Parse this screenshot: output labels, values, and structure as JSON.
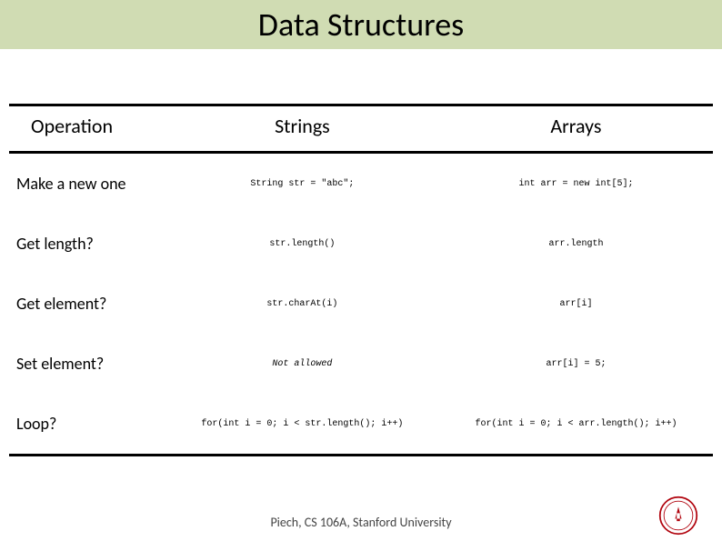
{
  "title": "Data Structures",
  "headers": {
    "operation": "Operation",
    "strings": "Strings",
    "arrays": "Arrays"
  },
  "rows": [
    {
      "op": "Make a new one",
      "strings": "String str = \"abc\";",
      "arrays": "int arr = new int[5];",
      "italic": false
    },
    {
      "op": "Get length?",
      "strings": "str.length()",
      "arrays": "arr.length",
      "italic": false
    },
    {
      "op": "Get element?",
      "strings": "str.charAt(i)",
      "arrays": "arr[i]",
      "italic": false
    },
    {
      "op": "Set element?",
      "strings": "Not allowed",
      "arrays": "arr[i] = 5;",
      "italic": true
    },
    {
      "op": "Loop?",
      "strings": "for(int i = 0; i < str.length(); i++)",
      "arrays": "for(int i = 0; i < arr.length(); i++)",
      "italic": false
    }
  ],
  "footer": "Piech, CS 106A, Stanford University",
  "seal_color": "#b1040e"
}
